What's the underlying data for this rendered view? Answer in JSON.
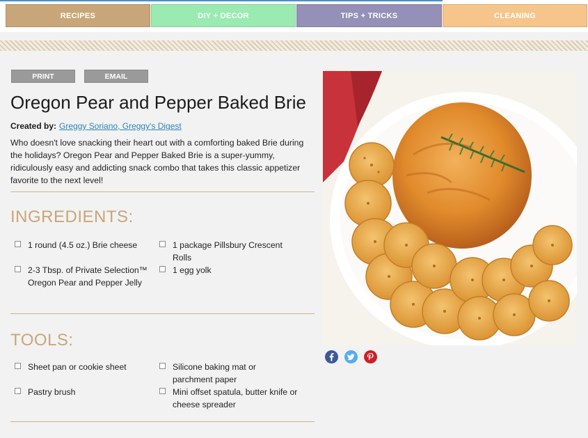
{
  "nav": {
    "items": [
      {
        "label": "RECIPES",
        "color": "#c9a679"
      },
      {
        "label": "DIY + DECOR",
        "color": "#9aeab2"
      },
      {
        "label": "TIPS + TRICKS",
        "color": "#9590b7"
      },
      {
        "label": "CLEANING",
        "color": "#f6c58b"
      }
    ]
  },
  "actions": {
    "print": "PRINT",
    "email": "EMAIL"
  },
  "recipe": {
    "title": "Oregon Pear and Pepper Baked Brie",
    "created_by_label": "Created by:",
    "author": "Greggy Soriano, Greggy's Digest",
    "description": "Who doesn't love snacking their heart out with a comforting baked Brie during the holidays? Oregon Pear and Pepper Baked Brie is a super-yummy, ridiculously easy and addicting snack combo that takes this classic appetizer favorite to the next level!"
  },
  "ingredients": {
    "heading": "INGREDIENTS:",
    "items": [
      "1 round (4.5 oz.) Brie cheese",
      "1 package Pillsbury Crescent Rolls",
      "2-3 Tbsp. of Private Selection™ Oregon Pear and Pepper Jelly",
      "1 egg yolk"
    ]
  },
  "tools": {
    "heading": "TOOLS:",
    "items": [
      "Sheet pan or cookie sheet",
      "Silicone baking mat or parchment paper",
      "Pastry brush",
      "Mini offset spatula, butter knife or cheese spreader"
    ]
  },
  "social": {
    "icons": [
      {
        "name": "facebook-icon",
        "glyph": "f",
        "color": "#3b5998"
      },
      {
        "name": "twitter-icon",
        "glyph": "t",
        "color": "#55acee"
      },
      {
        "name": "pinterest-icon",
        "glyph": "p",
        "color": "#cb2027"
      }
    ]
  },
  "colors": {
    "accent": "#c9a679",
    "link": "#2b84b8",
    "button_gray": "#9a9a9a"
  }
}
